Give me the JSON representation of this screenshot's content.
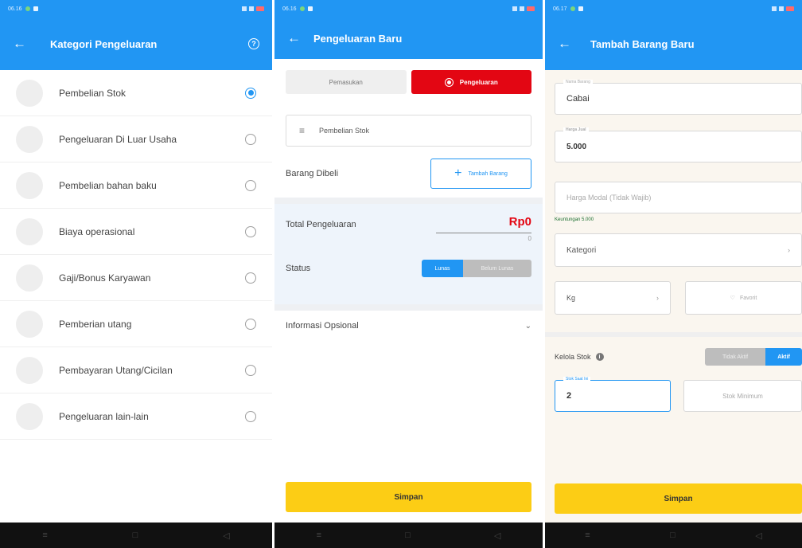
{
  "screen1": {
    "status_time": "06.16",
    "title": "Kategori Pengeluaran",
    "categories": [
      {
        "label": "Pembelian Stok",
        "selected": true
      },
      {
        "label": "Pengeluaran Di Luar Usaha",
        "selected": false
      },
      {
        "label": "Pembelian bahan baku",
        "selected": false
      },
      {
        "label": "Biaya operasional",
        "selected": false
      },
      {
        "label": "Gaji/Bonus Karyawan",
        "selected": false
      },
      {
        "label": "Pemberian utang",
        "selected": false
      },
      {
        "label": "Pembayaran Utang/Cicilan",
        "selected": false
      },
      {
        "label": "Pengeluaran lain-lain",
        "selected": false
      }
    ]
  },
  "screen2": {
    "status_time": "06.16",
    "title": "Pengeluaran Baru",
    "toggle_in": "Pemasukan",
    "toggle_out": "Pengeluaran",
    "category_value": "Pembelian Stok",
    "barang_label": "Barang Dibeli",
    "add_barang_label": "Tambah Barang",
    "total_label": "Total Pengeluaran",
    "total_amount": "Rp0",
    "total_input": "0",
    "status_label": "Status",
    "status_lunas": "Lunas",
    "status_belum": "Belum Lunas",
    "info_label": "Informasi Opsional",
    "save_label": "Simpan"
  },
  "screen3": {
    "status_time": "06.17",
    "title": "Tambah Barang Baru",
    "nama_label": "Nama Barang",
    "nama_value": "Cabai",
    "harga_label": "Harga Jual",
    "harga_value": "5.000",
    "modal_placeholder": "Harga Modal (Tidak Wajib)",
    "keuntungan_hint": "Keuntungan 5.000",
    "kategori_placeholder": "Kategori",
    "unit_value": "Kg",
    "favorit_label": "Favorit",
    "kelola_label": "Kelola Stok",
    "tidak_aktif": "Tidak Aktif",
    "aktif": "Aktif",
    "stok_label": "Stok Saat Ini",
    "stok_value": "2",
    "stok_min_placeholder": "Stok Minimum",
    "save_label": "Simpan"
  },
  "colors": {
    "primary": "#2196f3",
    "expense_red": "#e30613",
    "save_yellow": "#fccd15"
  }
}
